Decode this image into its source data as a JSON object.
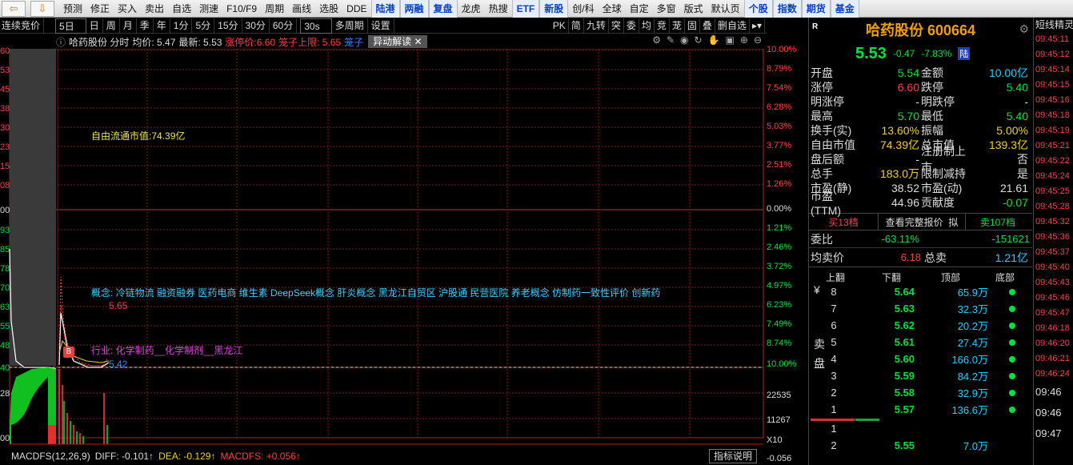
{
  "toolbar": {
    "items": [
      {
        "label": "预测",
        "style": ""
      },
      {
        "label": "修正",
        "style": ""
      },
      {
        "label": "买入",
        "style": ""
      },
      {
        "label": "卖出",
        "style": ""
      },
      {
        "label": "自选",
        "style": ""
      },
      {
        "label": "测速",
        "style": ""
      },
      {
        "label": "F10/F9",
        "style": ""
      },
      {
        "label": "周期",
        "style": ""
      },
      {
        "label": "画线",
        "style": ""
      },
      {
        "label": "选股",
        "style": ""
      },
      {
        "label": "DDE",
        "style": ""
      },
      {
        "label": "陆港",
        "style": "blue boxed"
      },
      {
        "label": "两融",
        "style": "blue boxed"
      },
      {
        "label": "复盘",
        "style": "blue boxed"
      },
      {
        "label": "龙虎",
        "style": ""
      },
      {
        "label": "热搜",
        "style": ""
      },
      {
        "label": "ETF",
        "style": "blue boxed"
      },
      {
        "label": "新股",
        "style": "blue boxed"
      },
      {
        "label": "创/科",
        "style": ""
      },
      {
        "label": "全球",
        "style": ""
      },
      {
        "label": "自定",
        "style": ""
      },
      {
        "label": "多窗",
        "style": ""
      },
      {
        "label": "版式",
        "style": ""
      },
      {
        "label": "默认页",
        "style": ""
      },
      {
        "label": "个股",
        "style": "blue boxed"
      },
      {
        "label": "指数",
        "style": "blue boxed"
      },
      {
        "label": "期货",
        "style": "blue boxed"
      },
      {
        "label": "基金",
        "style": "blue boxed"
      }
    ]
  },
  "periodbar": {
    "left_label": "连续竞价",
    "select": "5日",
    "periods": [
      "日",
      "周",
      "月",
      "季",
      "年",
      "1分",
      "5分",
      "15分",
      "30分",
      "60分"
    ],
    "sec_select": "30s",
    "multi": "多周期",
    "settings": "设置",
    "right_tools": [
      "PK",
      "简",
      "九转",
      "突",
      "委",
      "均",
      "竞",
      "茏",
      "固",
      "叠",
      "删自选"
    ]
  },
  "header": {
    "name": "哈药股份 分时",
    "avg": "均价: 5.47",
    "latest": "最新: 5.53",
    "limit_up": "涨停价:6.60",
    "cage": "笼子上限: 5.65",
    "cage2": "笼子",
    "badge": "异动解读",
    "badge_close": "✕"
  },
  "chart": {
    "left_axis": [
      "60",
      "53",
      "45",
      "38",
      "30",
      "23",
      "15",
      "08",
      "00",
      "93",
      "85",
      "78",
      "70",
      "63",
      "55",
      "48",
      "40",
      "28",
      "",
      "00"
    ],
    "right_axis": [
      "10.00%",
      "8.79%",
      "7.54%",
      "6.28%",
      "5.03%",
      "3.77%",
      "2.51%",
      "1.26%",
      "0.00%",
      "1.21%",
      "2.46%",
      "3.72%",
      "4.97%",
      "6.23%",
      "7.49%",
      "8.74%",
      "10.00%",
      "22535",
      "11267",
      "X10",
      "-0.056"
    ],
    "float_cap": "自由流通市值:74.39亿",
    "concepts": "概念: 冷链物流 融资融券 医药电商 维生素 DeepSeek概念 肝炎概念 黑龙江自贸区 沪股通 民营医院 养老概念 仿制药一致性评价 创新药",
    "industry": "行业: 化学制药__化学制剂__黑龙江",
    "cage_label": "5.65",
    "last_label": "5.42",
    "buy_marker": "B"
  },
  "macd": {
    "name": "MACDFS(12,26,9)",
    "diff": "DIFF: -0.101↑",
    "dea": "DEA: -0.129↑",
    "macdfs": "MACDFS: +0.056↑",
    "button": "指标说明"
  },
  "quote": {
    "mark": "R",
    "title": "哈药股份 600664",
    "price": "5.53",
    "change": "-0.47",
    "change_pct": "-7.83%",
    "lu": "陆",
    "rows": [
      {
        "l1": "开盘",
        "v1": "5.54",
        "c1": "c-g",
        "l2": "金额",
        "v2": "10.00亿",
        "c2": "c-c"
      },
      {
        "l1": "涨停",
        "v1": "6.60",
        "c1": "c-r",
        "l2": "跌停",
        "v2": "5.40",
        "c2": "c-g"
      },
      {
        "l1": "明涨停",
        "v1": "-",
        "c1": "c-w",
        "l2": "明跌停",
        "v2": "-",
        "c2": "c-w"
      },
      {
        "l1": "最高",
        "v1": "5.70",
        "c1": "c-g",
        "l2": "最低",
        "v2": "5.40",
        "c2": "c-g"
      },
      {
        "l1": "换手(实)",
        "v1": "13.60%",
        "c1": "c-y",
        "l2": "振幅",
        "v2": "5.00%",
        "c2": "c-y"
      },
      {
        "l1": "自由市值",
        "v1": "74.39亿",
        "c1": "c-y",
        "l2": "总市值",
        "v2": "139.3亿",
        "c2": "c-y"
      },
      {
        "l1": "盘后额",
        "v1": "-",
        "c1": "c-w",
        "l2": "注册制上市",
        "v2": "否",
        "c2": "c-w"
      },
      {
        "l1": "总手",
        "v1": "183.0万",
        "c1": "c-y",
        "l2": "限制减持",
        "v2": "是",
        "c2": "c-w"
      },
      {
        "l1": "市盈(静)",
        "v1": "38.52",
        "c1": "c-w",
        "l2": "市盈(动)",
        "v2": "21.61",
        "c2": "c-w"
      },
      {
        "l1": "市盈(TTM)",
        "v1": "44.96",
        "c1": "c-w",
        "l2": "贡献度",
        "v2": "-0.07",
        "c2": "c-g"
      }
    ],
    "tab_buy": "买13档",
    "tab_mid": "查看完整报价",
    "tab_mid2": "拟",
    "tab_sell": "卖107档",
    "weibi_label": "委比",
    "weibi_pct": "-63.11%",
    "weibi_val": "-151621",
    "jmj_label": "均卖价",
    "jmj_val": "6.18",
    "zongmai_label": "总卖",
    "zongmai_val": "1.21亿",
    "ob_headers": [
      "上翻",
      "下翻",
      "顶部",
      "底部"
    ],
    "side_sell": [
      "¥",
      "卖",
      "盘"
    ],
    "sell": [
      {
        "lvl": "8",
        "p": "5.64",
        "v": "65.9万"
      },
      {
        "lvl": "7",
        "p": "5.63",
        "v": "32.3万"
      },
      {
        "lvl": "6",
        "p": "5.62",
        "v": "20.2万"
      },
      {
        "lvl": "5",
        "p": "5.61",
        "v": "27.4万"
      },
      {
        "lvl": "4",
        "p": "5.60",
        "v": "166.0万"
      },
      {
        "lvl": "3",
        "p": "5.59",
        "v": "84.2万"
      },
      {
        "lvl": "2",
        "p": "5.58",
        "v": "32.9万"
      },
      {
        "lvl": "1",
        "p": "5.57",
        "v": "136.6万"
      }
    ],
    "buy": [
      {
        "lvl": "1",
        "p": "",
        "v": ""
      },
      {
        "lvl": "2",
        "p": "5.55",
        "v": "7.0万"
      }
    ]
  },
  "ticker": {
    "title": "短线精灵",
    "times": [
      "09:45:11",
      "09:45:12",
      "09:45:14",
      "09:45:15",
      "09:45:16",
      "09:45:18",
      "09:45:19",
      "09:45:21",
      "09:45:22",
      "09:45:24",
      "09:45:25",
      "09:45:28",
      "09:45:32",
      "09:45:36",
      "09:45:37",
      "09:45:40",
      "09:45:43",
      "09:45:46",
      "09:45:47",
      "09:46:18",
      "09:46:20",
      "09:46:21",
      "09:46:24"
    ],
    "tail": [
      "09:46",
      "09:46",
      "09:47"
    ]
  }
}
